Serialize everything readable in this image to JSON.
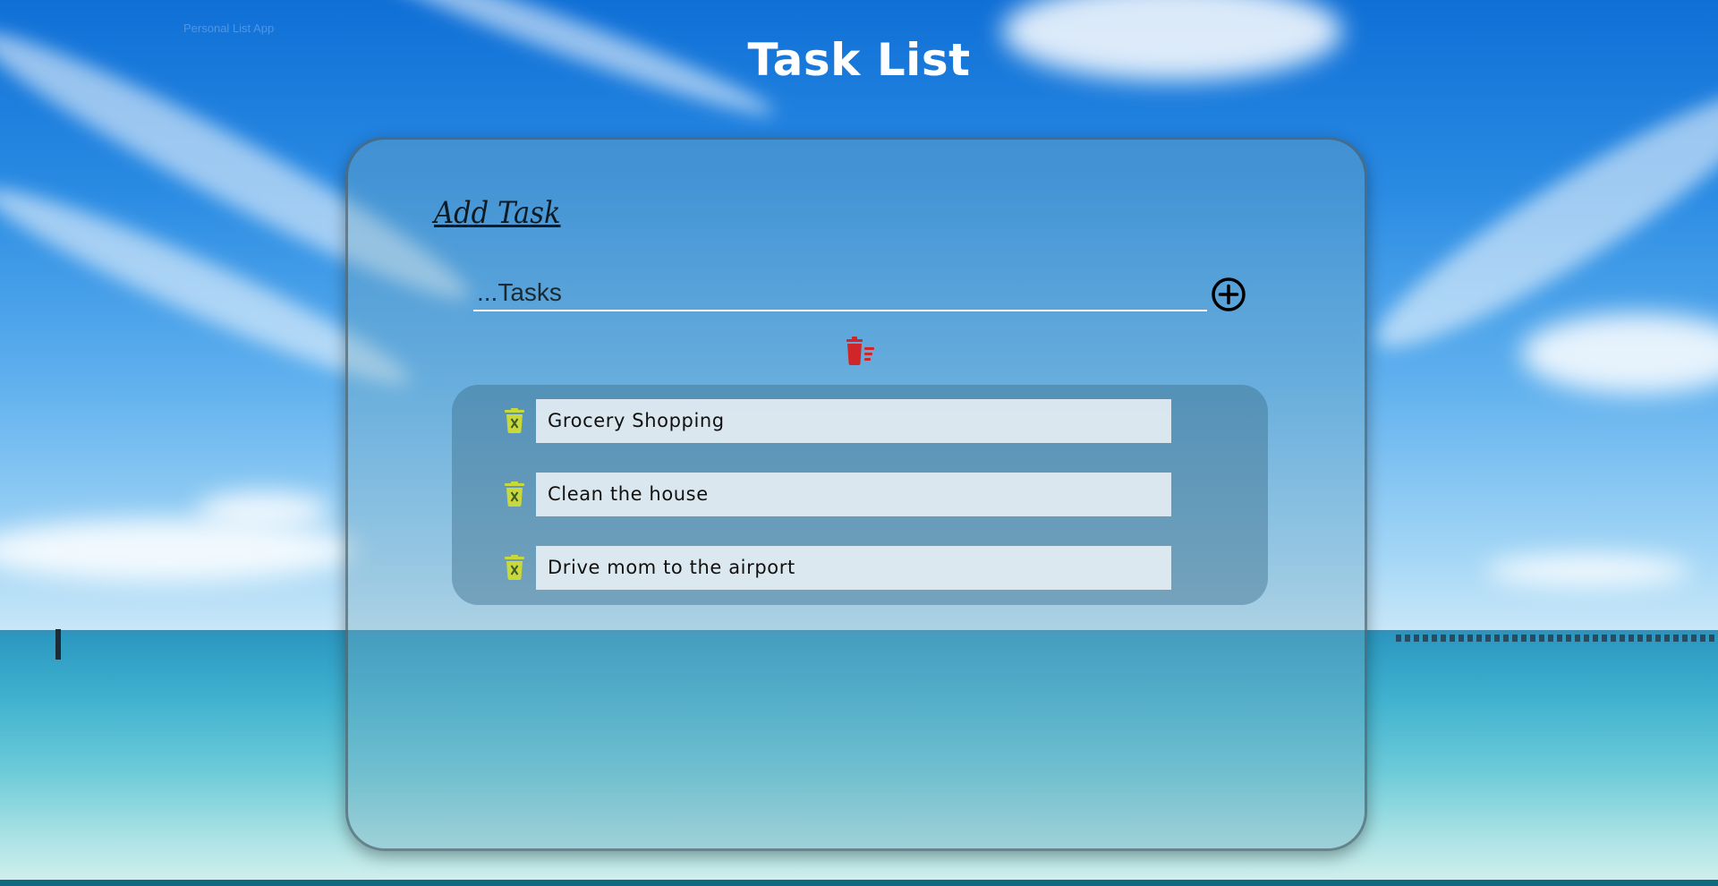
{
  "app": {
    "title": "Task List",
    "header_faint_label": "Personal List App"
  },
  "add_task": {
    "heading": "Add Task",
    "input_value": "",
    "input_placeholder": "...Tasks",
    "add_icon": "plus-circle-icon",
    "clear_all_icon": "trash-list-icon"
  },
  "tasks": [
    {
      "label": "Grocery Shopping",
      "delete_icon": "trash-x-icon"
    },
    {
      "label": "Clean the house",
      "delete_icon": "trash-x-icon"
    },
    {
      "label": "Drive mom to the airport",
      "delete_icon": "trash-x-icon"
    }
  ],
  "colors": {
    "clear_all_icon": "#d0262a",
    "task_delete_icon": "#c9d83a",
    "title_text": "#ffffff"
  }
}
